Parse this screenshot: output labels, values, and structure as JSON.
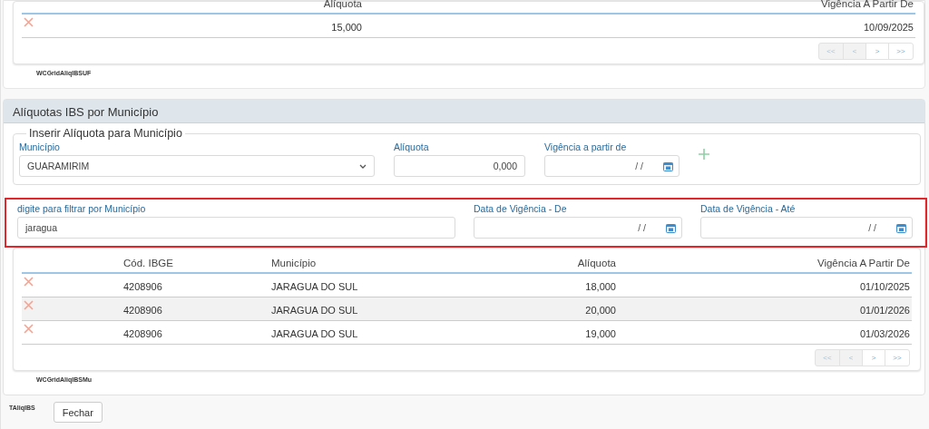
{
  "top_grid": {
    "columns": [
      "Alíquota",
      "Vigência A Partir De"
    ],
    "rows": [
      {
        "aliquota": "15,000",
        "vigencia": "10/09/2025"
      }
    ],
    "pager": [
      {
        "label": "<<",
        "disabled": true
      },
      {
        "label": "<",
        "disabled": true
      },
      {
        "label": ">",
        "disabled": false
      },
      {
        "label": ">>",
        "disabled": false
      }
    ],
    "caption": "WCGridAliqIBSUF"
  },
  "section": {
    "title": "Alíquotas IBS por Município",
    "insert": {
      "legend": "Inserir Alíquota para Município",
      "municipio": {
        "label": "Município",
        "value": "GUARAMIRIM"
      },
      "aliquota": {
        "label": "Alíquota",
        "value": "0,000"
      },
      "vigencia": {
        "label": "Vigência a partir de",
        "value": "/ /"
      }
    },
    "filter": {
      "municipio": {
        "label": "digite para filtrar por Município",
        "value": "jaragua"
      },
      "de": {
        "label": "Data de Vigência - De",
        "value": "/ /"
      },
      "ate": {
        "label": "Data de Vigência - Até",
        "value": "/ /"
      }
    },
    "grid": {
      "columns": [
        "Cód. IBGE",
        "Município",
        "Alíquota",
        "Vigência A Partir De"
      ],
      "rows": [
        {
          "codigo": "4208906",
          "municipio": "JARAGUA DO SUL",
          "aliquota": "18,000",
          "vigencia": "01/10/2025"
        },
        {
          "codigo": "4208906",
          "municipio": "JARAGUA DO SUL",
          "aliquota": "20,000",
          "vigencia": "01/01/2026"
        },
        {
          "codigo": "4208906",
          "municipio": "JARAGUA DO SUL",
          "aliquota": "19,000",
          "vigencia": "01/03/2026"
        }
      ],
      "pager": [
        {
          "label": "<<",
          "disabled": true
        },
        {
          "label": "<",
          "disabled": true
        },
        {
          "label": ">",
          "disabled": false
        },
        {
          "label": ">>",
          "disabled": false
        }
      ],
      "caption": "WCGridAliqIBSMu"
    }
  },
  "footer": {
    "caption": "TAliqIBS",
    "button": "Fechar"
  }
}
